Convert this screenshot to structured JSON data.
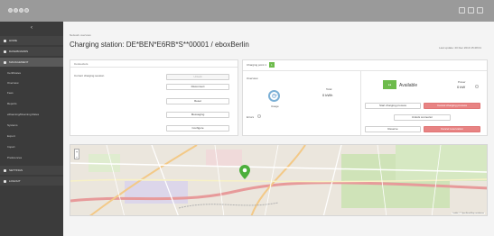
{
  "colors": {
    "topbar": "#9a9a9a",
    "sidebar": "#3b3b3b",
    "available": "#6dbb4b",
    "danger": "#e88383",
    "gauge": "#7bb0d6"
  },
  "sidebar": {
    "items": [
      {
        "label": "HOME",
        "icon": "home-icon"
      },
      {
        "label": "DASHBOARDS",
        "icon": "dashboard-icon"
      },
      {
        "label": "MANAGEMENT",
        "icon": "management-icon"
      },
      {
        "label": "Certificates",
        "icon": ""
      },
      {
        "label": "Overview",
        "icon": ""
      },
      {
        "label": "Fees",
        "icon": ""
      },
      {
        "label": "Reports",
        "icon": ""
      },
      {
        "label": "eRoaming/Roaming Rates",
        "icon": ""
      },
      {
        "label": "Systems",
        "icon": ""
      },
      {
        "label": "Export",
        "icon": ""
      },
      {
        "label": "Import",
        "icon": ""
      },
      {
        "label": "Preferences",
        "icon": ""
      },
      {
        "label": "SETTINGS",
        "icon": "settings-icon"
      },
      {
        "label": "LOGOUT",
        "icon": "logout-icon"
      }
    ]
  },
  "main": {
    "breadcrumb": "Network overview",
    "title": "Charging station: DE*BEN*E6RB*S**00001 / eboxBerlin",
    "last_update": "Last update: 20 Dec 2019 15:28:01"
  },
  "left_panel": {
    "header": "Connectors",
    "label": "Current charging session",
    "buttons": [
      "Unlock",
      "Disconnect",
      "Reset",
      "Messaging",
      "Configure"
    ]
  },
  "right_panel": {
    "cp_label": "Charging point 1",
    "cp_chip": "1",
    "overview_label": "Overview",
    "gauge_label": "Power",
    "gauge_caption": "Usage",
    "energy_label": "Total",
    "energy_value": "0 kWh",
    "status": "Available",
    "power_label": "Power",
    "power_value": "0 kW",
    "errors_label": "Errors",
    "buttons": {
      "start": "Start charging process",
      "stop": "Cancel charging process",
      "unlock": "Unlock connector",
      "reserve": "Reserve",
      "cancel_reservation": "Cancel reservation"
    }
  },
  "map": {
    "zoom_in": "+",
    "zoom_out": "−",
    "attribution": "Leaflet | © OpenStreetMap contributors"
  }
}
